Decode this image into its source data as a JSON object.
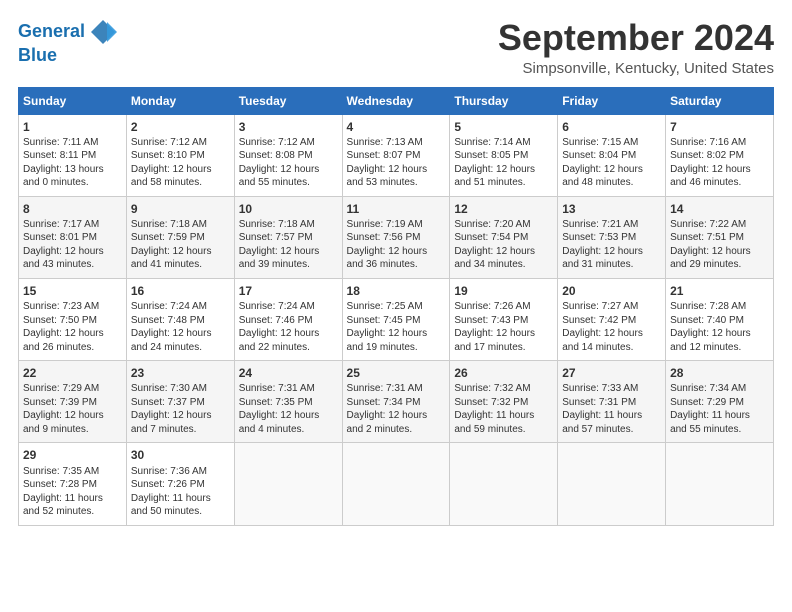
{
  "header": {
    "logo_line1": "General",
    "logo_line2": "Blue",
    "month_title": "September 2024",
    "location": "Simpsonville, Kentucky, United States"
  },
  "days_of_week": [
    "Sunday",
    "Monday",
    "Tuesday",
    "Wednesday",
    "Thursday",
    "Friday",
    "Saturday"
  ],
  "weeks": [
    [
      {
        "day": "1",
        "info": "Sunrise: 7:11 AM\nSunset: 8:11 PM\nDaylight: 13 hours\nand 0 minutes."
      },
      {
        "day": "2",
        "info": "Sunrise: 7:12 AM\nSunset: 8:10 PM\nDaylight: 12 hours\nand 58 minutes."
      },
      {
        "day": "3",
        "info": "Sunrise: 7:12 AM\nSunset: 8:08 PM\nDaylight: 12 hours\nand 55 minutes."
      },
      {
        "day": "4",
        "info": "Sunrise: 7:13 AM\nSunset: 8:07 PM\nDaylight: 12 hours\nand 53 minutes."
      },
      {
        "day": "5",
        "info": "Sunrise: 7:14 AM\nSunset: 8:05 PM\nDaylight: 12 hours\nand 51 minutes."
      },
      {
        "day": "6",
        "info": "Sunrise: 7:15 AM\nSunset: 8:04 PM\nDaylight: 12 hours\nand 48 minutes."
      },
      {
        "day": "7",
        "info": "Sunrise: 7:16 AM\nSunset: 8:02 PM\nDaylight: 12 hours\nand 46 minutes."
      }
    ],
    [
      {
        "day": "8",
        "info": "Sunrise: 7:17 AM\nSunset: 8:01 PM\nDaylight: 12 hours\nand 43 minutes."
      },
      {
        "day": "9",
        "info": "Sunrise: 7:18 AM\nSunset: 7:59 PM\nDaylight: 12 hours\nand 41 minutes."
      },
      {
        "day": "10",
        "info": "Sunrise: 7:18 AM\nSunset: 7:57 PM\nDaylight: 12 hours\nand 39 minutes."
      },
      {
        "day": "11",
        "info": "Sunrise: 7:19 AM\nSunset: 7:56 PM\nDaylight: 12 hours\nand 36 minutes."
      },
      {
        "day": "12",
        "info": "Sunrise: 7:20 AM\nSunset: 7:54 PM\nDaylight: 12 hours\nand 34 minutes."
      },
      {
        "day": "13",
        "info": "Sunrise: 7:21 AM\nSunset: 7:53 PM\nDaylight: 12 hours\nand 31 minutes."
      },
      {
        "day": "14",
        "info": "Sunrise: 7:22 AM\nSunset: 7:51 PM\nDaylight: 12 hours\nand 29 minutes."
      }
    ],
    [
      {
        "day": "15",
        "info": "Sunrise: 7:23 AM\nSunset: 7:50 PM\nDaylight: 12 hours\nand 26 minutes."
      },
      {
        "day": "16",
        "info": "Sunrise: 7:24 AM\nSunset: 7:48 PM\nDaylight: 12 hours\nand 24 minutes."
      },
      {
        "day": "17",
        "info": "Sunrise: 7:24 AM\nSunset: 7:46 PM\nDaylight: 12 hours\nand 22 minutes."
      },
      {
        "day": "18",
        "info": "Sunrise: 7:25 AM\nSunset: 7:45 PM\nDaylight: 12 hours\nand 19 minutes."
      },
      {
        "day": "19",
        "info": "Sunrise: 7:26 AM\nSunset: 7:43 PM\nDaylight: 12 hours\nand 17 minutes."
      },
      {
        "day": "20",
        "info": "Sunrise: 7:27 AM\nSunset: 7:42 PM\nDaylight: 12 hours\nand 14 minutes."
      },
      {
        "day": "21",
        "info": "Sunrise: 7:28 AM\nSunset: 7:40 PM\nDaylight: 12 hours\nand 12 minutes."
      }
    ],
    [
      {
        "day": "22",
        "info": "Sunrise: 7:29 AM\nSunset: 7:39 PM\nDaylight: 12 hours\nand 9 minutes."
      },
      {
        "day": "23",
        "info": "Sunrise: 7:30 AM\nSunset: 7:37 PM\nDaylight: 12 hours\nand 7 minutes."
      },
      {
        "day": "24",
        "info": "Sunrise: 7:31 AM\nSunset: 7:35 PM\nDaylight: 12 hours\nand 4 minutes."
      },
      {
        "day": "25",
        "info": "Sunrise: 7:31 AM\nSunset: 7:34 PM\nDaylight: 12 hours\nand 2 minutes."
      },
      {
        "day": "26",
        "info": "Sunrise: 7:32 AM\nSunset: 7:32 PM\nDaylight: 11 hours\nand 59 minutes."
      },
      {
        "day": "27",
        "info": "Sunrise: 7:33 AM\nSunset: 7:31 PM\nDaylight: 11 hours\nand 57 minutes."
      },
      {
        "day": "28",
        "info": "Sunrise: 7:34 AM\nSunset: 7:29 PM\nDaylight: 11 hours\nand 55 minutes."
      }
    ],
    [
      {
        "day": "29",
        "info": "Sunrise: 7:35 AM\nSunset: 7:28 PM\nDaylight: 11 hours\nand 52 minutes."
      },
      {
        "day": "30",
        "info": "Sunrise: 7:36 AM\nSunset: 7:26 PM\nDaylight: 11 hours\nand 50 minutes."
      },
      {
        "day": "",
        "info": ""
      },
      {
        "day": "",
        "info": ""
      },
      {
        "day": "",
        "info": ""
      },
      {
        "day": "",
        "info": ""
      },
      {
        "day": "",
        "info": ""
      }
    ]
  ]
}
